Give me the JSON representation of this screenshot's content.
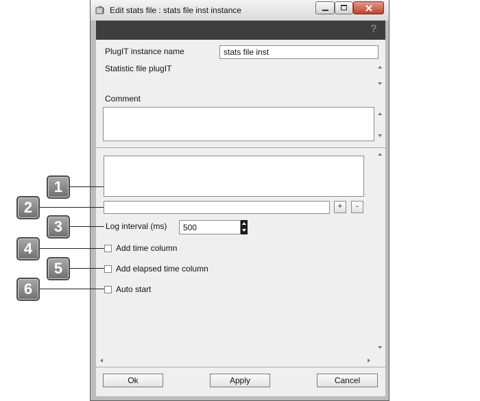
{
  "window": {
    "title": "Edit stats file : stats file inst instance"
  },
  "form": {
    "instance_name_label": "PlugIT instance name",
    "instance_name_value": "stats file inst",
    "description": "Statistic file plugIT",
    "comment_label": "Comment",
    "comment_value": ""
  },
  "config": {
    "add_button": "+",
    "remove_button": "-",
    "log_interval_label": "Log interval (ms)",
    "log_interval_value": "500",
    "add_time_column": "Add time column",
    "add_elapsed_time_column": "Add elapsed time column",
    "auto_start": "Auto start"
  },
  "footer": {
    "ok": "Ok",
    "apply": "Apply",
    "cancel": "Cancel"
  },
  "callouts": [
    "1",
    "2",
    "3",
    "4",
    "5",
    "6"
  ]
}
